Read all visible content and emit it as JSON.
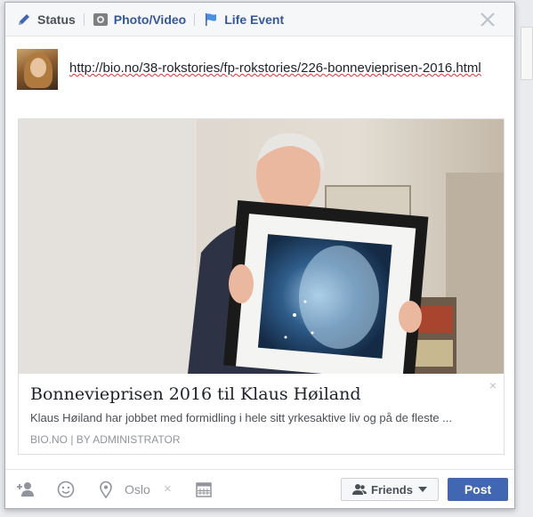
{
  "tabs": [
    {
      "label": "Status",
      "icon": "pencil-icon"
    },
    {
      "label": "Photo/Video",
      "icon": "camera-icon"
    },
    {
      "label": "Life Event",
      "icon": "flag-icon"
    }
  ],
  "composer": {
    "text": "http://bio.no/38-rokstories/fp-rokstories/226-bonnevieprisen-2016.html"
  },
  "preview": {
    "title": "Bonnevieprisen 2016 til Klaus Høiland",
    "description": "Klaus Høiland har jobbet med formidling i hele sitt yrkesaktive liv og på de fleste ...",
    "meta": "BIO.NO | BY ADMINISTRATOR",
    "close_glyph": "×"
  },
  "footer": {
    "location": "Oslo",
    "location_remove_glyph": "×",
    "audience_label": "Friends",
    "post_label": "Post"
  },
  "colors": {
    "accent": "#4267b2",
    "link": "#365899"
  }
}
